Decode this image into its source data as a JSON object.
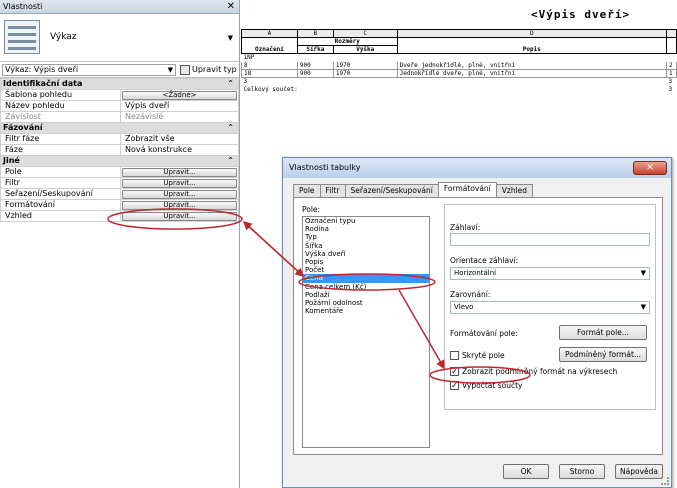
{
  "properties": {
    "title": "Vlastnosti",
    "close": "✕",
    "type_label": "Výkaz",
    "selector": "Výkaz: Výpis dveří",
    "edit_type": "Upravit typ",
    "groups": [
      {
        "name": "Identifikační data",
        "rows": [
          {
            "label": "Šablona pohledu",
            "value": "<Žádné>",
            "button": true
          },
          {
            "label": "Název pohledu",
            "value": "Výpis dveří"
          },
          {
            "label": "Závislost",
            "value": "Nezávislé",
            "grey": true
          }
        ]
      },
      {
        "name": "Fázování",
        "rows": [
          {
            "label": "Filtr fáze",
            "value": "Zobrazit vše"
          },
          {
            "label": "Fáze",
            "value": "Nová konstrukce"
          }
        ]
      },
      {
        "name": "Jiné",
        "rows": [
          {
            "label": "Pole",
            "value": "Upravit...",
            "button": true
          },
          {
            "label": "Filtr",
            "value": "Upravit...",
            "button": true
          },
          {
            "label": "Seřazení/Seskupování",
            "value": "Upravit...",
            "button": true
          },
          {
            "label": "Formátování",
            "value": "Upravit...",
            "button": true
          },
          {
            "label": "Vzhled",
            "value": "Upravit...",
            "button": true
          }
        ]
      }
    ]
  },
  "schedule": {
    "title": "<Výpis dveří>",
    "columns": [
      "A",
      "B",
      "C",
      "D",
      ""
    ],
    "group_header": "Rozměry",
    "headers": [
      "Označení",
      "Šířka",
      "Výška",
      "Popis",
      ""
    ],
    "group_row": "1NP",
    "rows": [
      [
        "8",
        "900",
        "1970",
        "Dveře jednokřídlé, plné, vnitřní",
        "2"
      ],
      [
        "18",
        "900",
        "1970",
        "Jednokřídlé dveře, plné, vnitřní",
        "1"
      ]
    ],
    "subtotal": "3",
    "subtotal_right": "3",
    "total_label": "Celkový součet:",
    "total_right": "3"
  },
  "dialog": {
    "title": "Vlastnosti tabulky",
    "close": "✕",
    "tabs": [
      "Pole",
      "Filtr",
      "Seřazení/Seskupování",
      "Formátování",
      "Vzhled"
    ],
    "active_tab": 3,
    "fields_label": "Pole:",
    "fields": [
      "Označení typu",
      "Rodina",
      "Typ",
      "Šířka",
      "Výška dveří",
      "Popis",
      "Počet",
      "Cena",
      "Cena celkem (Kč)",
      "Podlaží",
      "Požární odolnost",
      "Komentáře"
    ],
    "selected_field": 7,
    "heading_label": "Záhlaví:",
    "heading_value": "",
    "orientation_label": "Orientace záhlaví:",
    "orientation_value": "Horizontální",
    "alignment_label": "Zarovnání:",
    "alignment_value": "Vlevo",
    "field_format_label": "Formátování pole:",
    "field_format_button": "Formát pole...",
    "hidden_field": "Skryté pole",
    "conditional_button": "Podmíněný formát...",
    "show_conditional": "Zobrazit podmíněný formát na výkresech",
    "calc_totals": "Vypočtat součty",
    "ok": "OK",
    "cancel": "Storno",
    "help": "Nápověda"
  },
  "colors": {
    "highlight": "#c0272d",
    "selection": "#3399ff"
  }
}
